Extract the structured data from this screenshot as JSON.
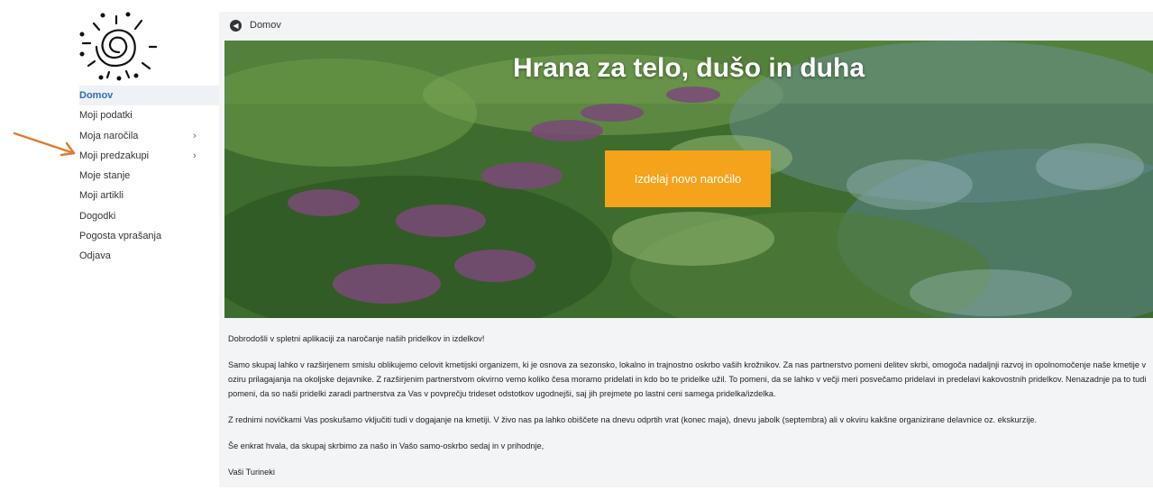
{
  "sidebar": {
    "items": [
      {
        "label": "Domov",
        "active": true,
        "has_submenu": false
      },
      {
        "label": "Moji podatki",
        "active": false,
        "has_submenu": false
      },
      {
        "label": "Moja naročila",
        "active": false,
        "has_submenu": true
      },
      {
        "label": "Moji predzakupi",
        "active": false,
        "has_submenu": true
      },
      {
        "label": "Moje stanje",
        "active": false,
        "has_submenu": false
      },
      {
        "label": "Moji artikli",
        "active": false,
        "has_submenu": false
      },
      {
        "label": "Dogodki",
        "active": false,
        "has_submenu": false
      },
      {
        "label": "Pogosta vprašanja",
        "active": false,
        "has_submenu": false
      },
      {
        "label": "Odjava",
        "active": false,
        "has_submenu": false
      }
    ],
    "chevron": "›"
  },
  "breadcrumb": {
    "label": "Domov",
    "icon": "back-arrow-icon"
  },
  "hero": {
    "title": "Hrana za telo, dušo in duha",
    "cta_label": "Izdelaj novo naročilo"
  },
  "content": {
    "paragraphs": [
      "Dobrodošli v spletni aplikaciji za naročanje naših pridelkov in izdelkov!",
      "Samo skupaj lahko v razširjenem smislu oblikujemo celovit kmetijski organizem, ki je osnova za sezonsko, lokalno in trajnostno oskrbo vaših krožnikov. Za nas partnerstvo pomeni delitev skrbi, omogoča nadaljnji razvoj in opolnomočenje naše kmetije v oziru prilagajanja na okoljske dejavnike. Z razširjenim partnerstvom okvirno vemo koliko česa moramo pridelati in kdo bo te pridelke užil. To pomeni, da se lahko v večji meri posvečamo pridelavi in predelavi kakovostnih pridelkov. Nenazadnje pa to tudi pomeni, da so naši pridelki zaradi partnerstva za Vas v povprečju trideset odstotkov ugodnejši, saj jih prejmete po lastni ceni samega pridelka/izdelka.",
      "Z rednimi novičkami Vas poskušamo vključiti tudi v dogajanje na kmetiji. V živo nas pa lahko obiščete na dnevu odprtih vrat (konec maja), dnevu jabolk (septembra) ali v okviru kakšne organizirane delavnice oz. ekskurzije.",
      "Še enkrat hvala, da skupaj skrbimo za našo in Vašo samo-oskrbo sedaj in v prihodnje,",
      "Vaši Turineki"
    ]
  },
  "colors": {
    "accent": "#f5a31a",
    "active_nav": "#2c6eb5",
    "arrow": "#e07a2e"
  }
}
